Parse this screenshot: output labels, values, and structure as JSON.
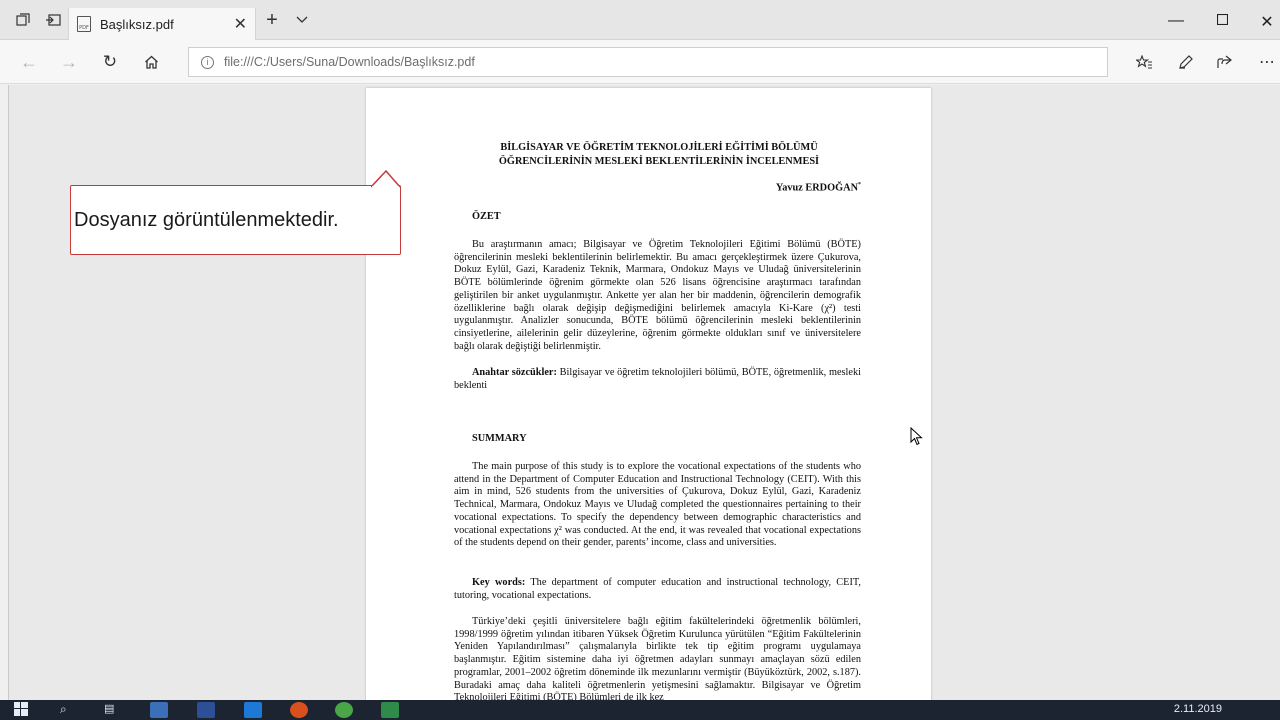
{
  "browser": {
    "tab_title": "Başlıksız.pdf",
    "url": "file:///C:/Users/Suna/Downloads/Başlıksız.pdf",
    "favicon_text": "PDF"
  },
  "callout": {
    "text": "Dosyanız görüntülenmektedir."
  },
  "document": {
    "title_line1": "BİLGİSAYAR VE ÖĞRETİM TEKNOLOJİLERİ EĞİTİMİ BÖLÜMÜ",
    "title_line2": "ÖĞRENCİLERİNİN MESLEKİ BEKLENTİLERİNİN İNCELENMESİ",
    "author": "Yavuz ERDOĞAN",
    "author_mark": "*",
    "ozet_heading": "ÖZET",
    "ozet_text": "Bu araştırmanın amacı; Bilgisayar ve Öğretim Teknolojileri Eğitimi Bölümü (BÖTE) öğrencilerinin mesleki beklentilerinin belirlemektir. Bu amacı gerçekleştirmek üzere Çukurova, Dokuz Eylül, Gazi, Karadeniz Teknik, Marmara, Ondokuz Mayıs ve Uludağ üniversitelerinin BÖTE bölümlerinde öğrenim görmekte olan 526 lisans öğrencisine araştırmacı tarafından geliştirilen bir anket uygulanmıştır. Ankette yer alan her bir maddenin, öğrencilerin demografik özelliklerine bağlı olarak değişip değişmediğini belirlemek amacıyla Ki-Kare (χ²) testi uygulanmıştır. Analizler sonucunda, BÖTE bölümü öğrencilerinin mesleki beklentilerinin cinsiyetlerine, ailelerinin gelir düzeylerine, öğrenim görmekte oldukları sınıf ve üniversitelere bağlı olarak değiştiği belirlenmiştir.",
    "keywords_tr_label": "Anahtar sözcükler:",
    "keywords_tr": "Bilgisayar ve öğretim teknolojileri bölümü, BÖTE, öğretmenlik, mesleki beklenti",
    "summary_heading": "SUMMARY",
    "summary_text": "The main purpose of this study is to explore the vocational expectations of the students who attend in the Department of Computer Education and Instructional Technology (CEIT). With this aim in mind, 526 students from the universities of Çukurova, Dokuz Eylül, Gazi, Karadeniz Technical, Marmara, Ondokuz Mayıs ve Uludağ completed the questionnaires pertaining to their vocational expectations. To specify the dependency between demographic characteristics and vocational expectations χ² was conducted. At the end, it was revealed that vocational expectations of the students depend on their gender, parents’ income, class and universities.",
    "keywords_en_label": "Key words:",
    "keywords_en": "The department of computer education and instructional technology, CEIT, tutoring, vocational expectations.",
    "intro_text": "Türkiye’deki çeşitli üniversitelere bağlı eğitim fakültelerindeki öğretmenlik bölümleri, 1998/1999 öğretim yılından itibaren Yüksek Öğretim Kurulunca yürütülen “Eğitim Fakültelerinin Yeniden Yapılandırılması” çalışmalarıyla birlikte tek tip eğitim programı uygulamaya başlanmıştır. Eğitim sistemine daha iyi öğretmen adayları sunmayı amaçlayan sözü edilen programlar, 2001–2002 öğretim döneminde ilk mezunlarını vermiştir (Büyüköztürk, 2002, s.187). Buradaki amaç daha kaliteli öğretmenlerin yetişmesini sağlamaktır. Bilgisayar ve Öğretim Teknolojileri Eğitimi (BÖTE) Bölümleri de ilk kez"
  },
  "taskbar": {
    "date": "2.11.2019"
  }
}
